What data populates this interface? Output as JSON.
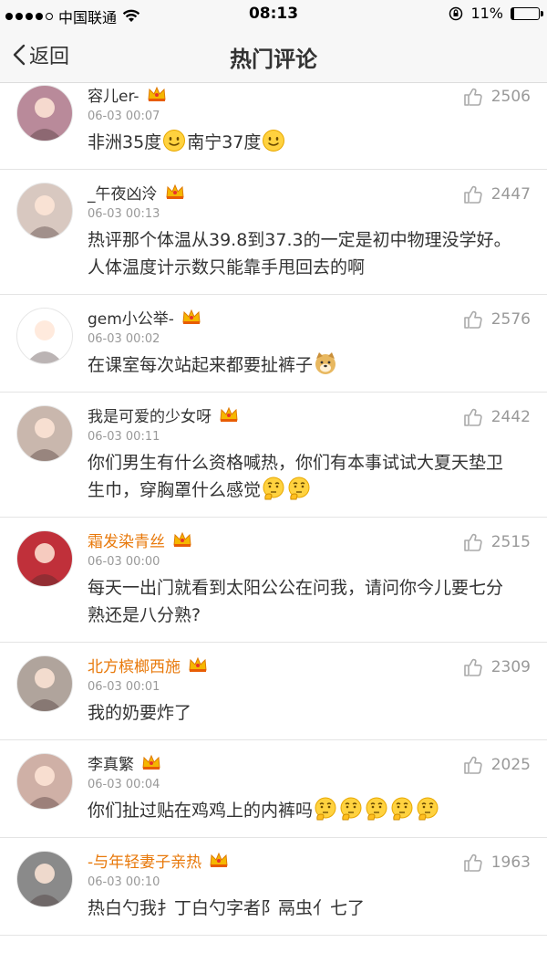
{
  "status_bar": {
    "carrier": "中国联通",
    "time": "08:13",
    "battery": "11%",
    "battery_level": 0.11
  },
  "nav": {
    "back_label": "返回",
    "title": "热门评论"
  },
  "colors": {
    "vip_name": "#e8790b",
    "normal_name": "#333333",
    "muted": "#999999"
  },
  "comments": [
    {
      "name": "容儿er-",
      "vip": false,
      "time": "06-03 00:07",
      "likes": "2506",
      "avatar_color": "#b98a9a",
      "text": "非洲35度",
      "emoji1": "smile-emoji",
      "text2": "南宁37度",
      "emoji2": "smile-emoji"
    },
    {
      "name": "_午夜凶泠",
      "vip": false,
      "time": "06-03 00:13",
      "likes": "2447",
      "avatar_color": "#d8c8c0",
      "text": "热评那个体温从39.8到37.3的一定是初中物理没学好。人体温度计示数只能靠手甩回去的啊"
    },
    {
      "name": "gem小公举-",
      "vip": false,
      "time": "06-03 00:02",
      "likes": "2576",
      "avatar_color": "#ffffff",
      "text": "在课室每次站起来都要扯裤子",
      "emoji1": "doge-emoji"
    },
    {
      "name": "我是可爱的少女呀",
      "vip": false,
      "time": "06-03 00:11",
      "likes": "2442",
      "avatar_color": "#c9b7ad",
      "text": "你们男生有什么资格喊热，你们有本事试试大夏天垫卫生巾，穿胸罩什么感觉",
      "emoji1": "thinking-emoji",
      "emoji2": "thinking-emoji"
    },
    {
      "name": "霜发染青丝",
      "vip": true,
      "time": "06-03 00:00",
      "likes": "2515",
      "avatar_color": "#c0303a",
      "text": "每天一出门就看到太阳公公在问我，请问你今儿要七分熟还是八分熟?"
    },
    {
      "name": "北方槟榔西施",
      "vip": true,
      "time": "06-03 00:01",
      "likes": "2309",
      "avatar_color": "#b0a49c",
      "text": "我的奶要炸了"
    },
    {
      "name": "李真繁",
      "vip": false,
      "time": "06-03 00:04",
      "likes": "2025",
      "avatar_color": "#cfb0a6",
      "text": "你们扯过贴在鸡鸡上的内裤吗",
      "emoji_count": 5
    },
    {
      "name": "-与年轻妻子亲热",
      "vip": true,
      "time": "06-03 00:10",
      "likes": "1963",
      "avatar_color": "#8a8a8a",
      "text": "热白勺我扌丁白勺字者阝鬲虫亻七了"
    }
  ]
}
